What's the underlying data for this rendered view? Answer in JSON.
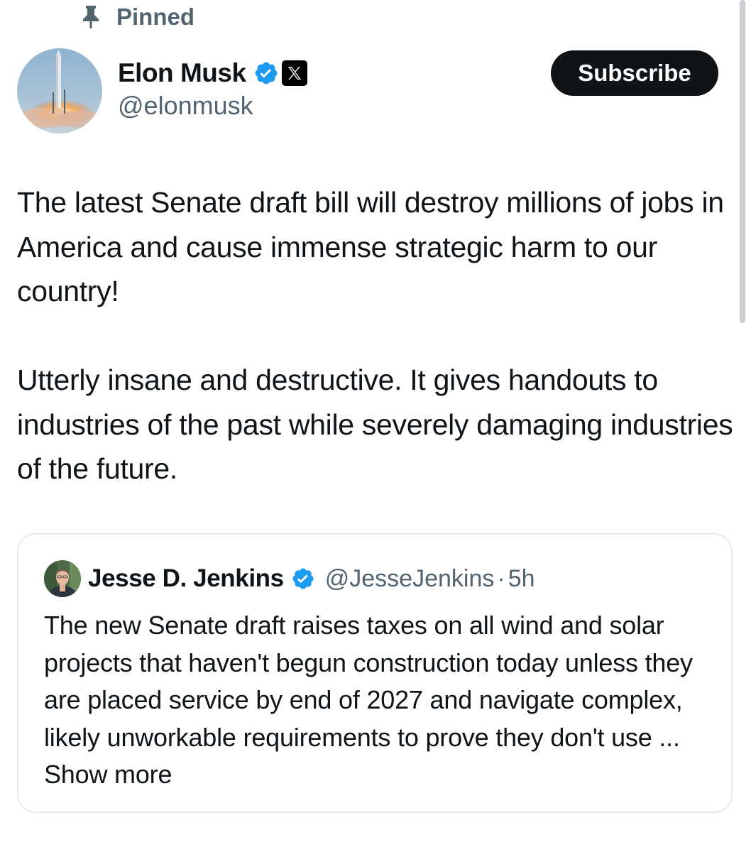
{
  "pinned": {
    "label": "Pinned",
    "icon": "pin-icon"
  },
  "author": {
    "name": "Elon Musk",
    "handle": "@elonmusk",
    "verified_icon": "verified-badge-icon",
    "affiliate_icon": "x-logo-icon"
  },
  "subscribe_button": {
    "label": "Subscribe"
  },
  "post": {
    "paragraph_1": "The latest Senate draft bill will destroy millions of jobs in America and cause immense strategic harm to our country!",
    "paragraph_2": "Utterly insane and destructive. It gives handouts to industries of the past while severely damaging industries of the future."
  },
  "quote": {
    "name": "Jesse D. Jenkins",
    "handle": "@JesseJenkins",
    "separator": "·",
    "time": "5h",
    "text": "The new Senate draft raises taxes on all wind and solar projects that haven't begun construction today unless they are placed service by end of 2027 and navigate complex, likely unworkable requirements to prove they don't use ...",
    "show_more": "Show more"
  },
  "colors": {
    "primary_text": "#0f1419",
    "secondary_text": "#536471",
    "verified_blue": "#1d9bf0",
    "button_bg": "#0f1419",
    "border": "#e6e9eb"
  }
}
